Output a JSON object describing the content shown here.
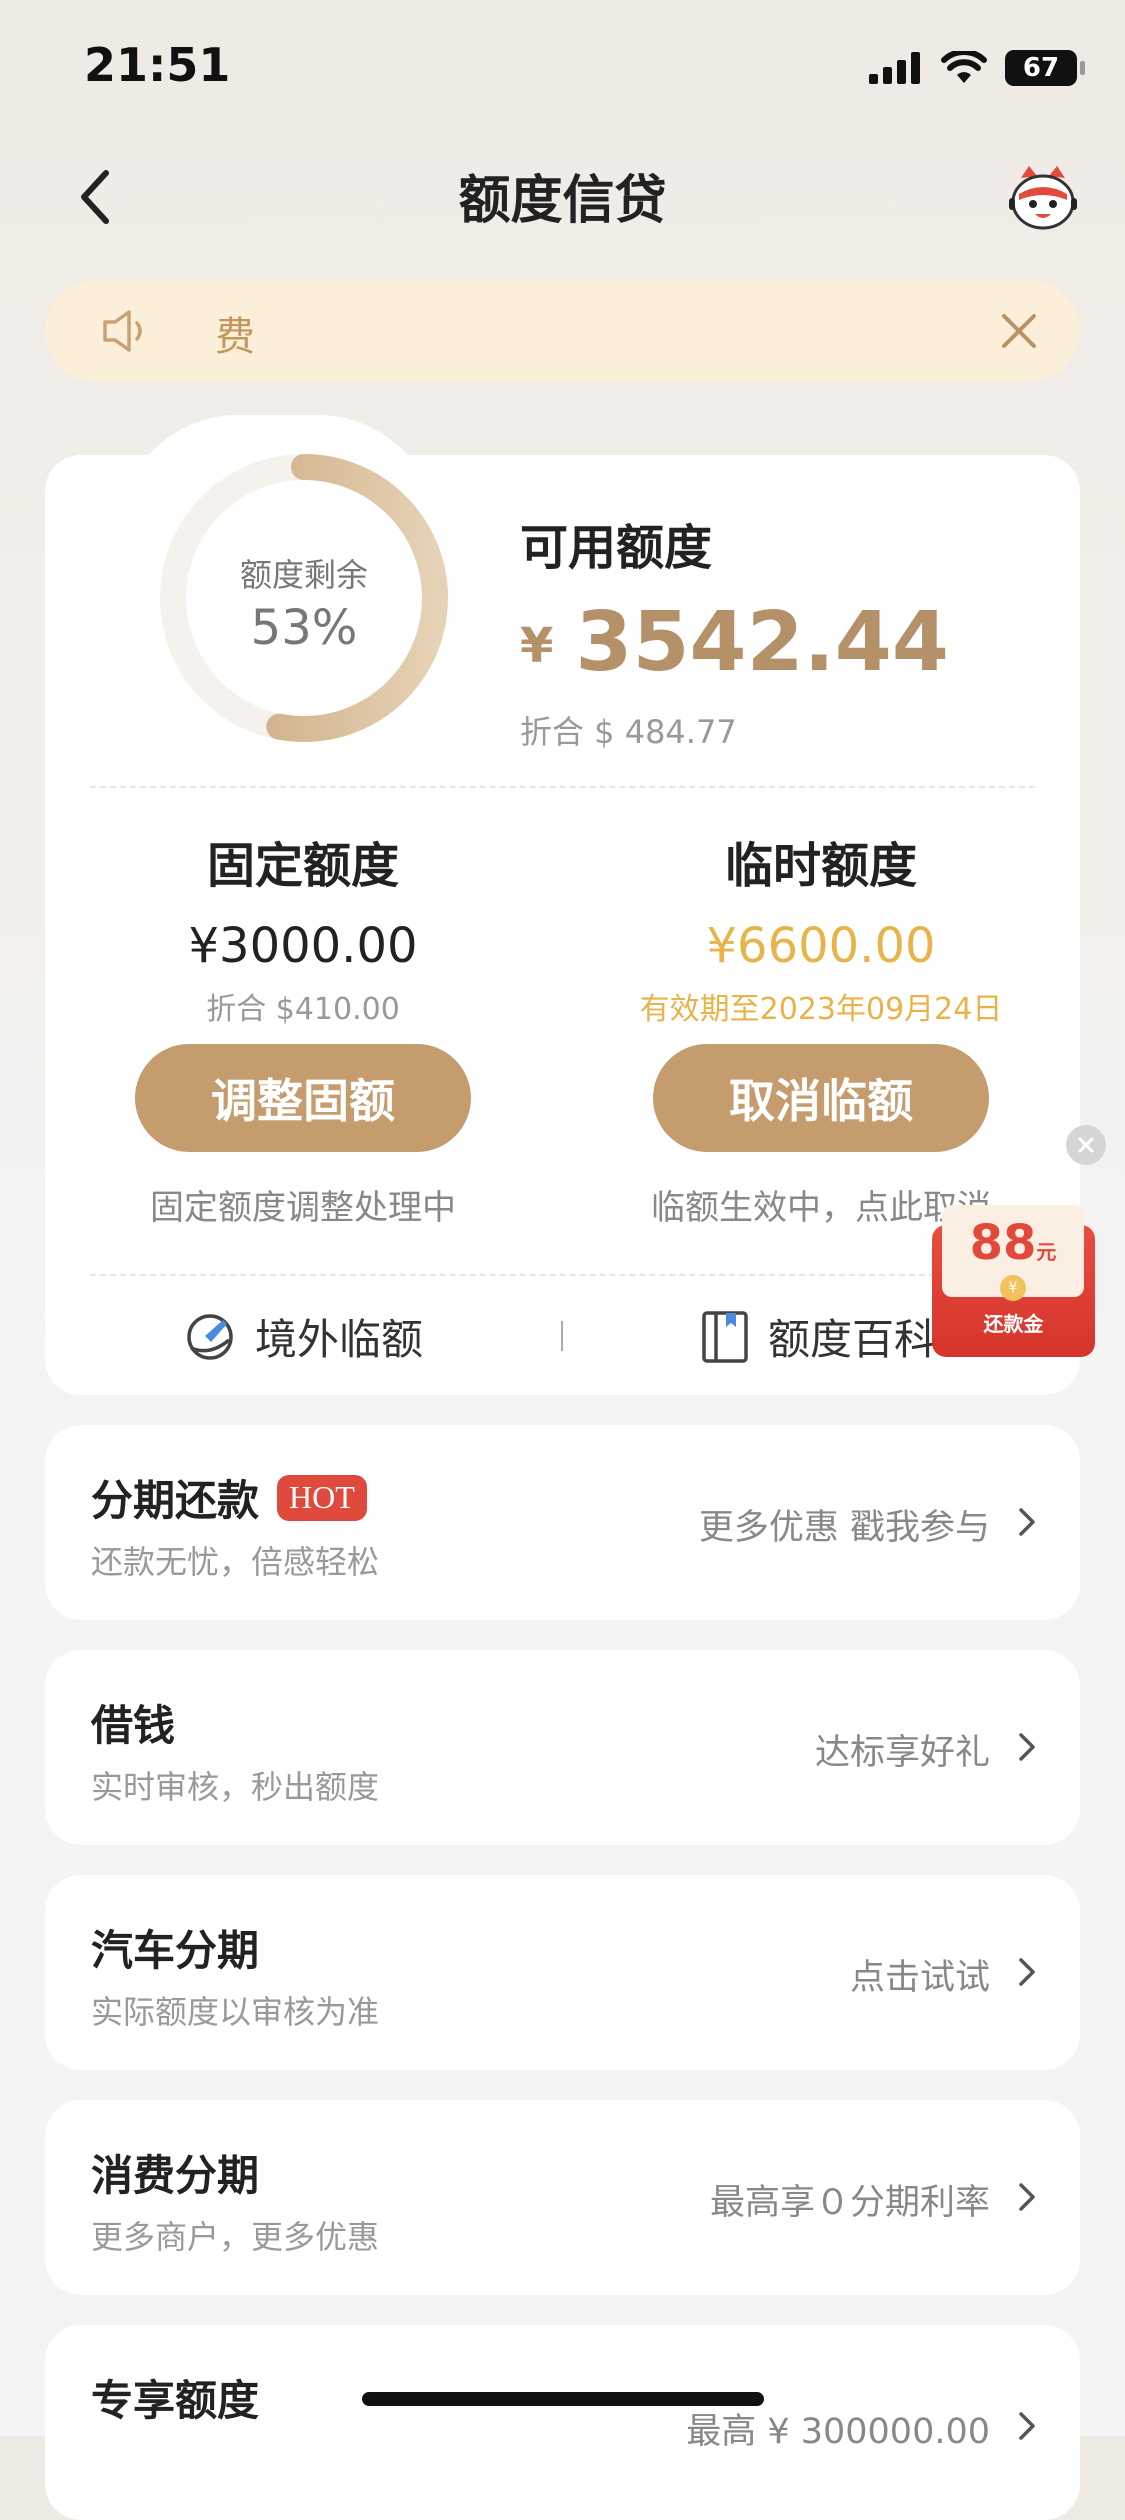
{
  "status_bar": {
    "time": "21:51",
    "battery": "67"
  },
  "nav": {
    "title": "额度信贷"
  },
  "notice": {
    "text": "费"
  },
  "credit": {
    "ring_label": "额度剩余",
    "ring_percent": "53%",
    "remaining_fraction": 0.53,
    "available_label": "可用额度",
    "available_currency": "¥",
    "available_amount": "3542.44",
    "available_converted": "折合 $ 484.77"
  },
  "fixed": {
    "title": "固定额度",
    "amount": "¥3000.00",
    "converted": "折合 $410.00",
    "button": "调整固额",
    "status": "固定额度调整处理中"
  },
  "temp": {
    "title": "临时额度",
    "amount": "¥6600.00",
    "valid_until": "有效期至2023年09月24日",
    "button": "取消临额",
    "status": "临额生效中，点此取消"
  },
  "tools": {
    "overseas": "境外临额",
    "encyclopedia": "额度百科"
  },
  "promo": {
    "amount": "88",
    "unit": "元",
    "label": "还款金"
  },
  "services": [
    {
      "title": "分期还款",
      "badge": "HOT",
      "subtitle": "还款无忧，倍感轻松",
      "right": "更多优惠 戳我参与"
    },
    {
      "title": "借钱",
      "subtitle": "实时审核，秒出额度",
      "right": "达标享好礼"
    },
    {
      "title": "汽车分期",
      "subtitle": "实际额度以审核为准",
      "right": "点击试试"
    },
    {
      "title": "消费分期",
      "subtitle": "更多商户，更多优惠",
      "right": "最高享０分期利率"
    },
    {
      "title": "专享额度",
      "subtitle": "",
      "right": "最高 ¥ 300000.00"
    }
  ],
  "colors": {
    "gold": "#c59c6d",
    "amount_gold": "#b5916a",
    "temp_yellow": "#e8b44a",
    "hot_red": "#e04a3c"
  }
}
